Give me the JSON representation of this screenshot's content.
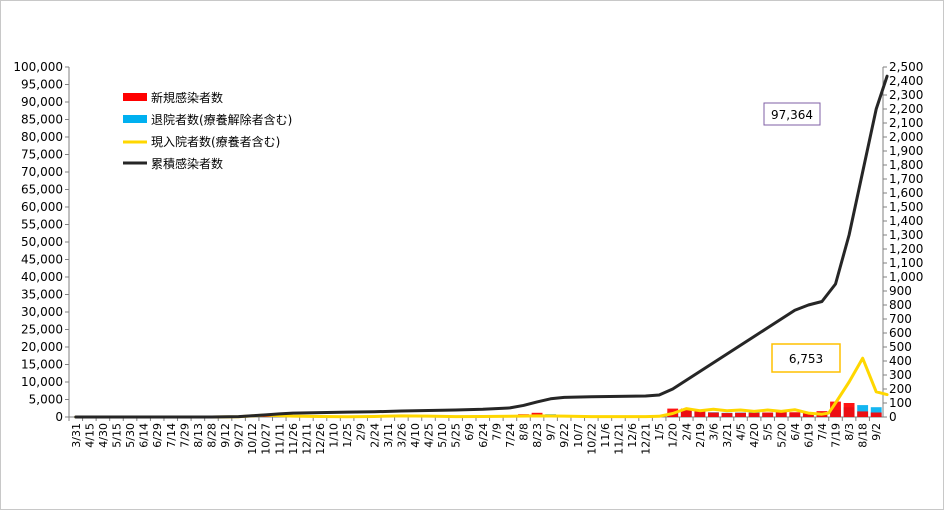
{
  "chart_data": {
    "type": "bar",
    "title": "",
    "xlabel": "",
    "ylabel": "",
    "ylim": [
      0,
      100000
    ],
    "y2lim": [
      0,
      2500
    ],
    "grid": false,
    "legend_position": "top-left",
    "y_ticks": [
      "0",
      "5,000",
      "10,000",
      "15,000",
      "20,000",
      "25,000",
      "30,000",
      "35,000",
      "40,000",
      "45,000",
      "50,000",
      "55,000",
      "60,000",
      "65,000",
      "70,000",
      "75,000",
      "80,000",
      "85,000",
      "90,000",
      "95,000",
      "100,000"
    ],
    "y2_ticks": [
      "0",
      "100",
      "200",
      "300",
      "400",
      "500",
      "600",
      "700",
      "800",
      "900",
      "1,000",
      "1,100",
      "1,200",
      "1,300",
      "1,400",
      "1,500",
      "1,600",
      "1,700",
      "1,800",
      "1,900",
      "2,000",
      "2,100",
      "2,200",
      "2,300",
      "2,400",
      "2,500"
    ],
    "x_ticks": [
      "3/31",
      "4/15",
      "4/30",
      "5/15",
      "5/30",
      "6/14",
      "6/29",
      "7/14",
      "7/29",
      "8/13",
      "8/28",
      "9/12",
      "9/27",
      "10/12",
      "10/27",
      "11/11",
      "11/26",
      "12/11",
      "12/26",
      "1/10",
      "1/25",
      "2/9",
      "2/24",
      "3/11",
      "3/26",
      "4/10",
      "4/25",
      "5/10",
      "5/25",
      "6/9",
      "6/24",
      "7/9",
      "7/24",
      "8/8",
      "8/23",
      "9/7",
      "9/22",
      "10/7",
      "10/22",
      "11/6",
      "11/21",
      "12/6",
      "12/21",
      "1/5",
      "1/20",
      "2/4",
      "2/19",
      "3/6",
      "3/21",
      "4/5",
      "4/20",
      "5/5",
      "5/20",
      "6/4",
      "6/19",
      "7/4",
      "7/19",
      "8/3",
      "8/18",
      "9/2"
    ],
    "series": [
      {
        "name": "新規感染者数",
        "type": "bar",
        "axis": "right",
        "color": "#ff0000",
        "points": [
          [
            10,
            0
          ],
          [
            11,
            1
          ],
          [
            12,
            3
          ],
          [
            13,
            8
          ],
          [
            14,
            14
          ],
          [
            15,
            10
          ],
          [
            16,
            6
          ],
          [
            17,
            8
          ],
          [
            18,
            6
          ],
          [
            19,
            4
          ],
          [
            20,
            3
          ],
          [
            21,
            4
          ],
          [
            22,
            6
          ],
          [
            23,
            8
          ],
          [
            24,
            10
          ],
          [
            25,
            8
          ],
          [
            26,
            6
          ],
          [
            27,
            5
          ],
          [
            28,
            4
          ],
          [
            29,
            5
          ],
          [
            30,
            6
          ],
          [
            31,
            5
          ],
          [
            32,
            8
          ],
          [
            33,
            20
          ],
          [
            34,
            30
          ],
          [
            35,
            18
          ],
          [
            36,
            10
          ],
          [
            37,
            6
          ],
          [
            38,
            4
          ],
          [
            39,
            3
          ],
          [
            40,
            3
          ],
          [
            41,
            3
          ],
          [
            42,
            4
          ],
          [
            43,
            10
          ],
          [
            44,
            60
          ],
          [
            45,
            60
          ],
          [
            46,
            40
          ],
          [
            47,
            32
          ],
          [
            48,
            28
          ],
          [
            49,
            30
          ],
          [
            50,
            30
          ],
          [
            51,
            32
          ],
          [
            52,
            36
          ],
          [
            53,
            34
          ],
          [
            54,
            32
          ],
          [
            55,
            42
          ],
          [
            56,
            110
          ],
          [
            57,
            100
          ],
          [
            58,
            40
          ],
          [
            59,
            32
          ]
        ],
        "annotation": ""
      },
      {
        "name": "退院者数(療養解除者含む)",
        "type": "bar",
        "axis": "right",
        "color": "#00b0f0",
        "points": [
          [
            10,
            0
          ],
          [
            11,
            0
          ],
          [
            12,
            1
          ],
          [
            13,
            4
          ],
          [
            14,
            10
          ],
          [
            15,
            12
          ],
          [
            16,
            8
          ],
          [
            17,
            8
          ],
          [
            18,
            6
          ],
          [
            19,
            4
          ],
          [
            20,
            3
          ],
          [
            21,
            3
          ],
          [
            22,
            5
          ],
          [
            23,
            7
          ],
          [
            24,
            9
          ],
          [
            25,
            9
          ],
          [
            26,
            7
          ],
          [
            27,
            6
          ],
          [
            28,
            4
          ],
          [
            29,
            4
          ],
          [
            30,
            5
          ],
          [
            31,
            5
          ],
          [
            32,
            6
          ],
          [
            33,
            12
          ],
          [
            34,
            22
          ],
          [
            35,
            20
          ],
          [
            36,
            12
          ],
          [
            37,
            8
          ],
          [
            38,
            5
          ],
          [
            39,
            3
          ],
          [
            40,
            3
          ],
          [
            41,
            3
          ],
          [
            42,
            3
          ],
          [
            43,
            5
          ],
          [
            44,
            30
          ],
          [
            45,
            52
          ],
          [
            46,
            40
          ],
          [
            47,
            34
          ],
          [
            48,
            30
          ],
          [
            49,
            32
          ],
          [
            50,
            36
          ],
          [
            51,
            32
          ],
          [
            52,
            34
          ],
          [
            53,
            32
          ],
          [
            54,
            28
          ],
          [
            55,
            26
          ],
          [
            56,
            50
          ],
          [
            57,
            70
          ],
          [
            58,
            85
          ],
          [
            59,
            70
          ]
        ]
      },
      {
        "name": "現入院者数(療養者含む)",
        "type": "line",
        "axis": "right",
        "color": "#ffd700",
        "points": [
          [
            0,
            0
          ],
          [
            10,
            0
          ],
          [
            12,
            2
          ],
          [
            13,
            8
          ],
          [
            14,
            14
          ],
          [
            15,
            10
          ],
          [
            16,
            6
          ],
          [
            18,
            4
          ],
          [
            20,
            2
          ],
          [
            22,
            4
          ],
          [
            24,
            8
          ],
          [
            26,
            6
          ],
          [
            28,
            3
          ],
          [
            30,
            4
          ],
          [
            32,
            5
          ],
          [
            34,
            8
          ],
          [
            36,
            6
          ],
          [
            38,
            3
          ],
          [
            40,
            3
          ],
          [
            42,
            3
          ],
          [
            43,
            5
          ],
          [
            44,
            25
          ],
          [
            45,
            60
          ],
          [
            46,
            45
          ],
          [
            47,
            55
          ],
          [
            48,
            45
          ],
          [
            49,
            50
          ],
          [
            50,
            40
          ],
          [
            51,
            50
          ],
          [
            52,
            40
          ],
          [
            53,
            52
          ],
          [
            54,
            28
          ],
          [
            55,
            20
          ],
          [
            55.5,
            28
          ],
          [
            56,
            100
          ],
          [
            57,
            250
          ],
          [
            58,
            420
          ],
          [
            59,
            180
          ],
          [
            59.8,
            160
          ]
        ],
        "annotation": "6,753"
      },
      {
        "name": "累積感染者数",
        "type": "line",
        "axis": "left",
        "color": "#262626",
        "points": [
          [
            0,
            0
          ],
          [
            10,
            10
          ],
          [
            12,
            120
          ],
          [
            13,
            350
          ],
          [
            14,
            600
          ],
          [
            15,
            900
          ],
          [
            16,
            1100
          ],
          [
            18,
            1250
          ],
          [
            20,
            1400
          ],
          [
            22,
            1500
          ],
          [
            24,
            1700
          ],
          [
            26,
            1850
          ],
          [
            28,
            2000
          ],
          [
            30,
            2200
          ],
          [
            32,
            2600
          ],
          [
            33,
            3300
          ],
          [
            34,
            4300
          ],
          [
            35,
            5200
          ],
          [
            36,
            5600
          ],
          [
            38,
            5800
          ],
          [
            40,
            5900
          ],
          [
            42,
            6000
          ],
          [
            43,
            6300
          ],
          [
            44,
            8000
          ],
          [
            45,
            10500
          ],
          [
            46,
            13000
          ],
          [
            47,
            15500
          ],
          [
            48,
            18000
          ],
          [
            49,
            20500
          ],
          [
            50,
            23000
          ],
          [
            51,
            25500
          ],
          [
            52,
            28000
          ],
          [
            53,
            30500
          ],
          [
            54,
            32000
          ],
          [
            55,
            33000
          ],
          [
            56,
            38000
          ],
          [
            57,
            52000
          ],
          [
            58,
            70000
          ],
          [
            59,
            88000
          ],
          [
            59.8,
            97364
          ]
        ],
        "annotation": "97,364"
      }
    ]
  }
}
